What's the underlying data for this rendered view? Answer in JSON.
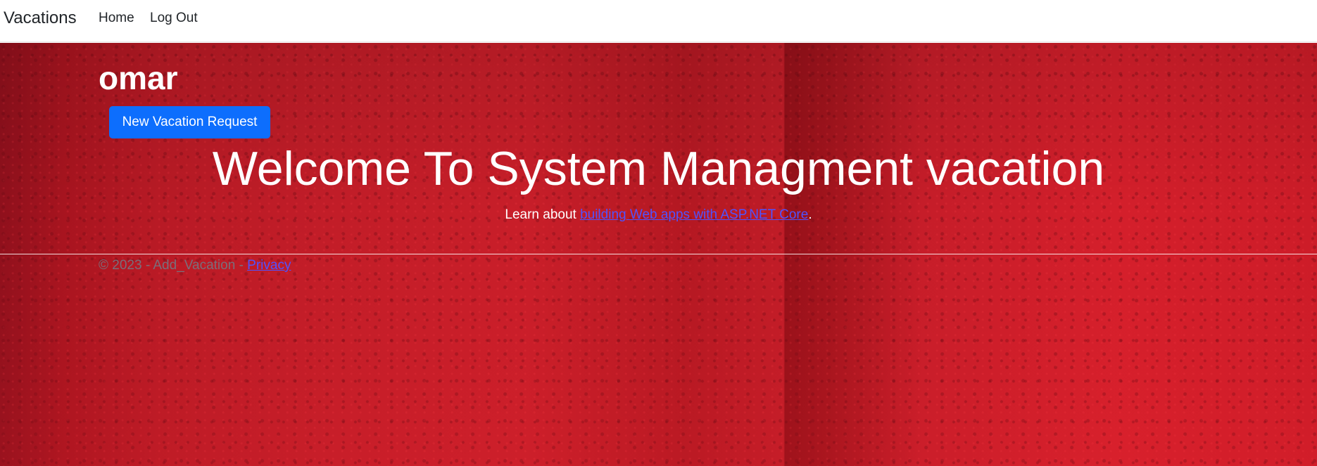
{
  "navbar": {
    "brand": "Vacations",
    "links": [
      {
        "label": "Home"
      },
      {
        "label": "Log Out"
      }
    ]
  },
  "main": {
    "username": "omar",
    "new_request_button": "New Vacation Request",
    "welcome_title": "Welcome To System Managment vacation",
    "learn_prefix": "Learn about ",
    "learn_link": "building Web apps with ASP.NET Core",
    "learn_suffix": "."
  },
  "footer": {
    "copyright": "© 2023 - Add_Vacation - ",
    "privacy_link": "Privacy"
  },
  "colors": {
    "primary_button": "#0d6efd",
    "link": "#4f53ff",
    "background_red": "#c81e29"
  }
}
